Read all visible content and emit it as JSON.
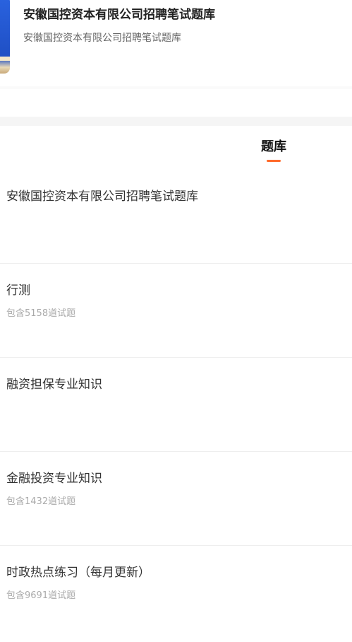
{
  "header": {
    "title": "安徽国控资本有限公司招聘笔试题库",
    "subtitle": "安徽国控资本有限公司招聘笔试题库",
    "accent_color": "#2a63e0"
  },
  "tabs": [
    {
      "label": "题库",
      "active": true
    }
  ],
  "tab_accent_color": "#ff6a2b",
  "list": {
    "items": [
      {
        "title": "安徽国控资本有限公司招聘笔试题库",
        "count": ""
      },
      {
        "title": "行测",
        "count": "包含5158道试题"
      },
      {
        "title": "融资担保专业知识",
        "count": ""
      },
      {
        "title": "金融投资专业知识",
        "count": "包含1432道试题"
      },
      {
        "title": "时政热点练习（每月更新）",
        "count": "包含9691道试题"
      }
    ]
  }
}
